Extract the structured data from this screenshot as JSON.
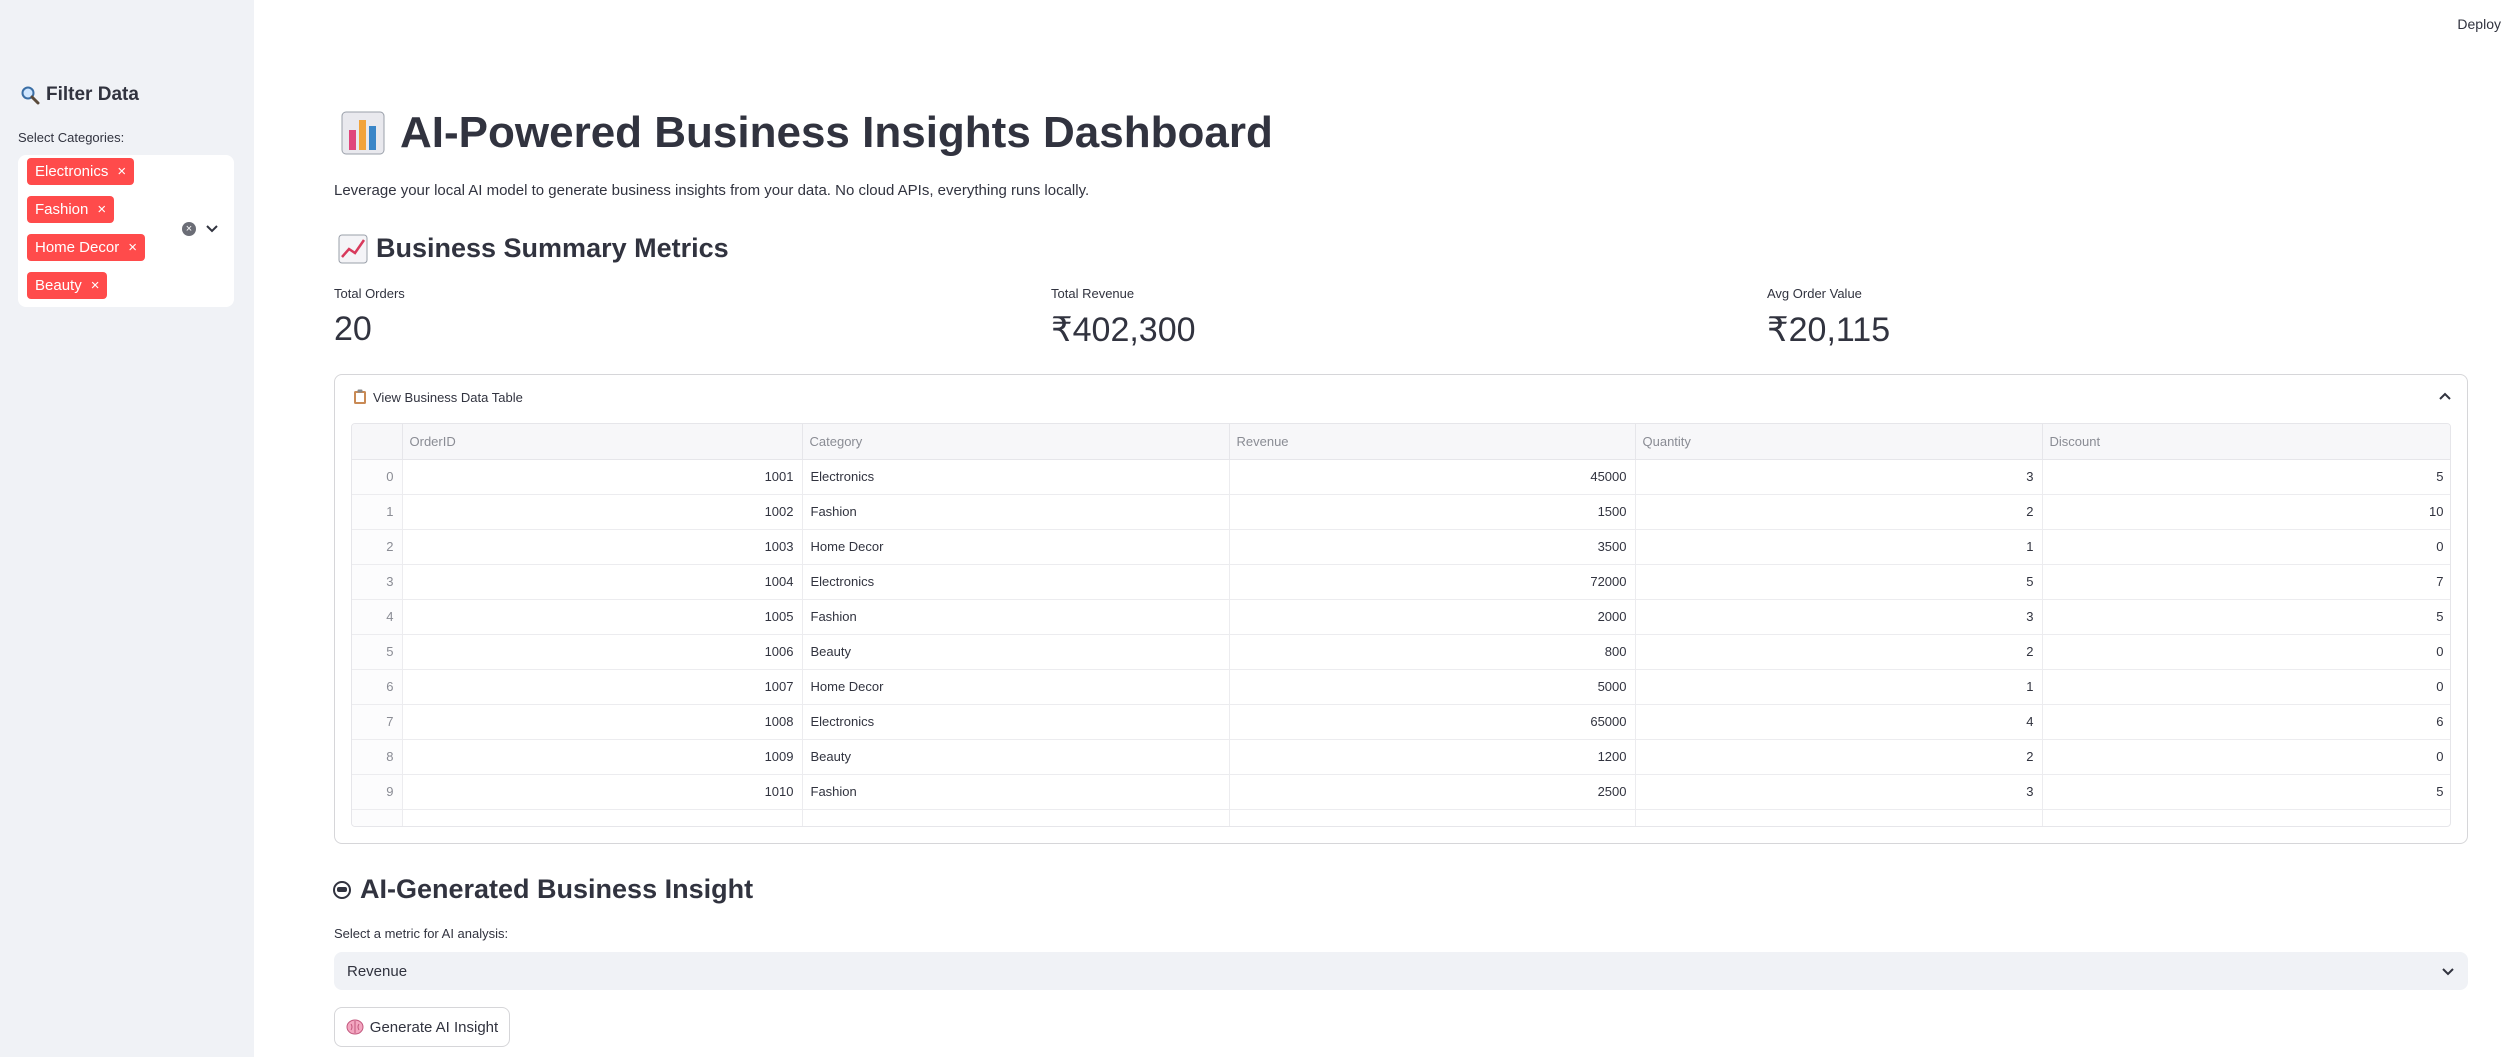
{
  "header": {
    "deploy_label": "Deploy"
  },
  "sidebar": {
    "title": "Filter Data",
    "title_icon": "magnifier-icon",
    "categories_label": "Select Categories:",
    "selected_categories": [
      "Electronics",
      "Fashion",
      "Home Decor",
      "Beauty"
    ],
    "chip_color": "#ff4b4b"
  },
  "main": {
    "title": "AI-Powered Business Insights Dashboard",
    "title_icon": "bar-chart-icon",
    "subtitle": "Leverage your local AI model to generate business insights from your data. No cloud APIs, everything runs locally.",
    "summary_heading": "Business Summary Metrics",
    "summary_icon": "chart-increasing-icon",
    "metrics": [
      {
        "label": "Total Orders",
        "value": "20"
      },
      {
        "label": "Total Revenue",
        "value": "₹402,300"
      },
      {
        "label": "Avg Order Value",
        "value": "₹20,115"
      }
    ],
    "expander": {
      "label": "View Business Data Table",
      "icon": "clipboard-icon",
      "columns": [
        "OrderID",
        "Category",
        "Revenue",
        "Quantity",
        "Discount"
      ],
      "rows": [
        {
          "index": "0",
          "OrderID": "1001",
          "Category": "Electronics",
          "Revenue": "45000",
          "Quantity": "3",
          "Discount": "5"
        },
        {
          "index": "1",
          "OrderID": "1002",
          "Category": "Fashion",
          "Revenue": "1500",
          "Quantity": "2",
          "Discount": "10"
        },
        {
          "index": "2",
          "OrderID": "1003",
          "Category": "Home Decor",
          "Revenue": "3500",
          "Quantity": "1",
          "Discount": "0"
        },
        {
          "index": "3",
          "OrderID": "1004",
          "Category": "Electronics",
          "Revenue": "72000",
          "Quantity": "5",
          "Discount": "7"
        },
        {
          "index": "4",
          "OrderID": "1005",
          "Category": "Fashion",
          "Revenue": "2000",
          "Quantity": "3",
          "Discount": "5"
        },
        {
          "index": "5",
          "OrderID": "1006",
          "Category": "Beauty",
          "Revenue": "800",
          "Quantity": "2",
          "Discount": "0"
        },
        {
          "index": "6",
          "OrderID": "1007",
          "Category": "Home Decor",
          "Revenue": "5000",
          "Quantity": "1",
          "Discount": "0"
        },
        {
          "index": "7",
          "OrderID": "1008",
          "Category": "Electronics",
          "Revenue": "65000",
          "Quantity": "4",
          "Discount": "6"
        },
        {
          "index": "8",
          "OrderID": "1009",
          "Category": "Beauty",
          "Revenue": "1200",
          "Quantity": "2",
          "Discount": "0"
        },
        {
          "index": "9",
          "OrderID": "1010",
          "Category": "Fashion",
          "Revenue": "2500",
          "Quantity": "3",
          "Discount": "5"
        }
      ]
    },
    "insight_heading": "AI-Generated Business Insight",
    "insight_icon": "robot-icon",
    "metric_select_label": "Select a metric for AI analysis:",
    "metric_select_value": "Revenue",
    "generate_button_label": "Generate AI Insight",
    "generate_button_icon": "brain-icon"
  }
}
